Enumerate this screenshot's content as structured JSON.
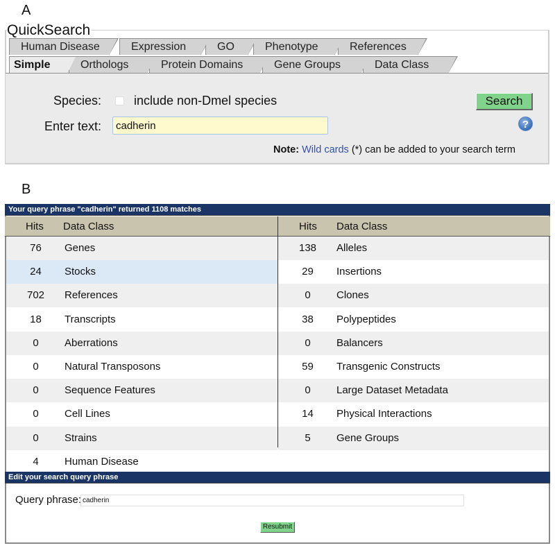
{
  "panel_labels": {
    "a": "A",
    "b": "B"
  },
  "quicksearch": {
    "title": "QuickSearch",
    "tabs_top": [
      "Human Disease",
      "Expression",
      "GO",
      "Phenotype",
      "References"
    ],
    "tabs_bottom": [
      "Simple",
      "Orthologs",
      "Protein Domains",
      "Gene Groups",
      "Data Class"
    ],
    "active_tab": "Simple",
    "species_label": "Species:",
    "species_checkbox_label": "include non-Dmel species",
    "species_checked": false,
    "enter_text_label": "Enter text:",
    "enter_text_value": "cadherin",
    "search_button": "Search",
    "help_icon": "question-circle-icon",
    "note_prefix": "Note:",
    "note_link": "Wild cards",
    "note_suffix": "(*) can be added to your search term"
  },
  "results": {
    "header": "Your query phrase \"cadherin\" returned 1108 matches",
    "col_hits": "Hits",
    "col_class": "Data Class",
    "left": [
      {
        "hits": "76",
        "class": "Genes"
      },
      {
        "hits": "24",
        "class": "Stocks"
      },
      {
        "hits": "702",
        "class": "References"
      },
      {
        "hits": "18",
        "class": "Transcripts"
      },
      {
        "hits": "0",
        "class": "Aberrations"
      },
      {
        "hits": "0",
        "class": "Natural Transposons"
      },
      {
        "hits": "0",
        "class": "Sequence Features"
      },
      {
        "hits": "0",
        "class": "Cell Lines"
      },
      {
        "hits": "0",
        "class": "Strains"
      },
      {
        "hits": "4",
        "class": "Human Disease"
      }
    ],
    "right": [
      {
        "hits": "138",
        "class": "Alleles"
      },
      {
        "hits": "29",
        "class": "Insertions"
      },
      {
        "hits": "0",
        "class": "Clones"
      },
      {
        "hits": "38",
        "class": "Polypeptides"
      },
      {
        "hits": "0",
        "class": "Balancers"
      },
      {
        "hits": "59",
        "class": "Transgenic Constructs"
      },
      {
        "hits": "0",
        "class": "Large Dataset Metadata"
      },
      {
        "hits": "14",
        "class": "Physical Interactions"
      },
      {
        "hits": "5",
        "class": "Gene Groups"
      }
    ],
    "highlighted_row": "Stocks"
  },
  "edit": {
    "header": "Edit your search query phrase",
    "query_label": "Query phrase:",
    "query_value": "cadherin",
    "resubmit_button": "Resubmit"
  },
  "colors": {
    "navbar": "#1a3466",
    "column_header": "#c9c4ae",
    "highlight_row": "#dbe9f6",
    "button_green": "#7fd38a",
    "input_yellow": "#fffacd",
    "link_blue": "#3551a8"
  }
}
